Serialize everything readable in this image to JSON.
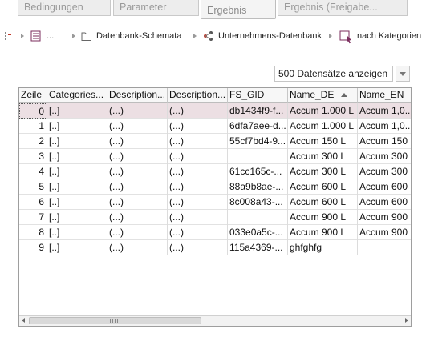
{
  "tabs": [
    {
      "label": "Bedingungen"
    },
    {
      "label": "Parameter"
    },
    {
      "label": "Ergebnis"
    },
    {
      "label": "Ergebnis (Freigabe..."
    }
  ],
  "breadcrumb": {
    "ellipsis": "...",
    "items": [
      {
        "label": "Datenbank-Schemata"
      },
      {
        "label": "Unternehmens-Datenbank"
      },
      {
        "label": "nach Kategorien"
      }
    ]
  },
  "records_select": {
    "value": "500 Datensätze anzeigen"
  },
  "grid": {
    "columns": [
      "Zeile",
      "Categories...",
      "Description...",
      "Description...",
      "FS_GID",
      "Name_DE",
      "Name_EN"
    ],
    "rows": [
      [
        "0",
        "[..]",
        "(...)",
        "(...)",
        "db1434f9-f...",
        "Accum 1.000 L",
        "Accum 1,0..."
      ],
      [
        "1",
        "[..]",
        "(...)",
        "(...)",
        "6dfa7aee-d...",
        "Accum 1.000 L",
        "Accum 1,0..."
      ],
      [
        "2",
        "[..]",
        "(...)",
        "(...)",
        "55cf7bd4-9...",
        "Accum 150 L",
        "Accum 150"
      ],
      [
        "3",
        "[..]",
        "(...)",
        "(...)",
        "",
        "Accum 300 L",
        "Accum 300"
      ],
      [
        "4",
        "[..]",
        "(...)",
        "(...)",
        "61cc165c-...",
        "Accum 300 L",
        "Accum 300"
      ],
      [
        "5",
        "[..]",
        "(...)",
        "(...)",
        "88a9b8ae-...",
        "Accum 600 L",
        "Accum 600"
      ],
      [
        "6",
        "[..]",
        "(...)",
        "(...)",
        "8c008a43-...",
        "Accum 600 L",
        "Accum 600"
      ],
      [
        "7",
        "[..]",
        "(...)",
        "(...)",
        "",
        "Accum 900 L",
        "Accum 900"
      ],
      [
        "8",
        "[..]",
        "(...)",
        "(...)",
        "033e0a5c-...",
        "Accum 900 L",
        "Accum 900"
      ],
      [
        "9",
        "[..]",
        "(...)",
        "(...)",
        "115a4369-...",
        "ghfghfg",
        ""
      ]
    ]
  },
  "colors": {
    "selected_row": "#ecdfe3",
    "tab_bg": "#ededed",
    "folder_icon": "#666666",
    "schema_icon": "#c0392b",
    "report_icon": "#7b2d5e"
  },
  "icons": [
    "drag-handle-icon",
    "report-icon",
    "folder-icon",
    "database-schema-icon",
    "cursor-select-icon",
    "sort-ascending-icon",
    "dropdown-arrow-icon"
  ]
}
